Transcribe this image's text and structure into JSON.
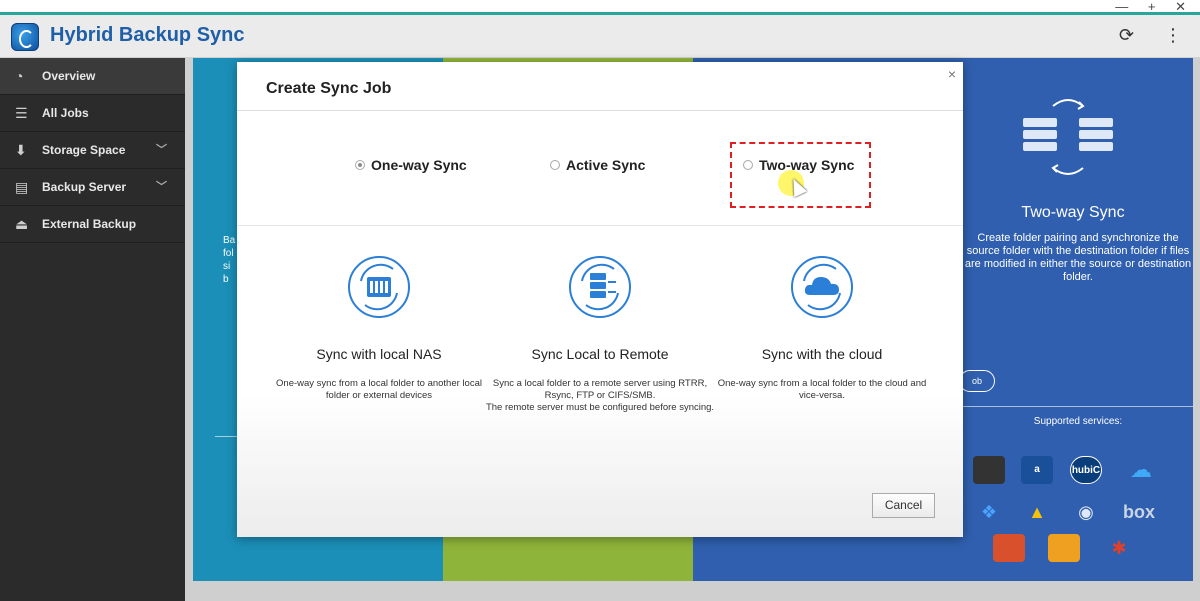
{
  "window": {
    "controls": "— + ✕"
  },
  "app": {
    "title": "Hybrid Backup Sync"
  },
  "sidebar": {
    "items": [
      {
        "label": "Overview",
        "icon": "gauge-icon"
      },
      {
        "label": "All Jobs",
        "icon": "list-icon"
      },
      {
        "label": "Storage Space",
        "icon": "download-icon"
      },
      {
        "label": "Backup Server",
        "icon": "server-icon"
      },
      {
        "label": "External Backup",
        "icon": "external-drive-icon"
      }
    ]
  },
  "background": {
    "p1_peek": "Ba\nfol\nsi\nb",
    "two_way_heading": "Two-way Sync",
    "two_way_desc": "Create folder pairing and synchronize the source folder with the destination folder if files are modified in either the source or destination folder.",
    "job_button": "ob",
    "supported": "Supported services:",
    "services": [
      "box"
    ]
  },
  "modal": {
    "title": "Create Sync Job",
    "close": "×",
    "options": [
      {
        "label": "One-way Sync",
        "checked": true
      },
      {
        "label": "Active Sync",
        "checked": false
      },
      {
        "label": "Two-way Sync",
        "checked": false
      }
    ],
    "features": [
      {
        "title": "Sync with local NAS",
        "desc": "One-way sync from a local folder to another local folder or external devices"
      },
      {
        "title": "Sync Local to Remote",
        "desc": "Sync a local folder to a remote server using RTRR, Rsync, FTP or CIFS/SMB.\nThe remote server must be configured before syncing."
      },
      {
        "title": "Sync with the cloud",
        "desc": "One-way sync from a local folder to the cloud and vice-versa."
      }
    ],
    "cancel": "Cancel"
  },
  "colors": {
    "accent": "#2aa59c",
    "title_blue": "#1f5fa8",
    "icon_blue": "#2b7fd6",
    "highlight": "#e02020"
  }
}
